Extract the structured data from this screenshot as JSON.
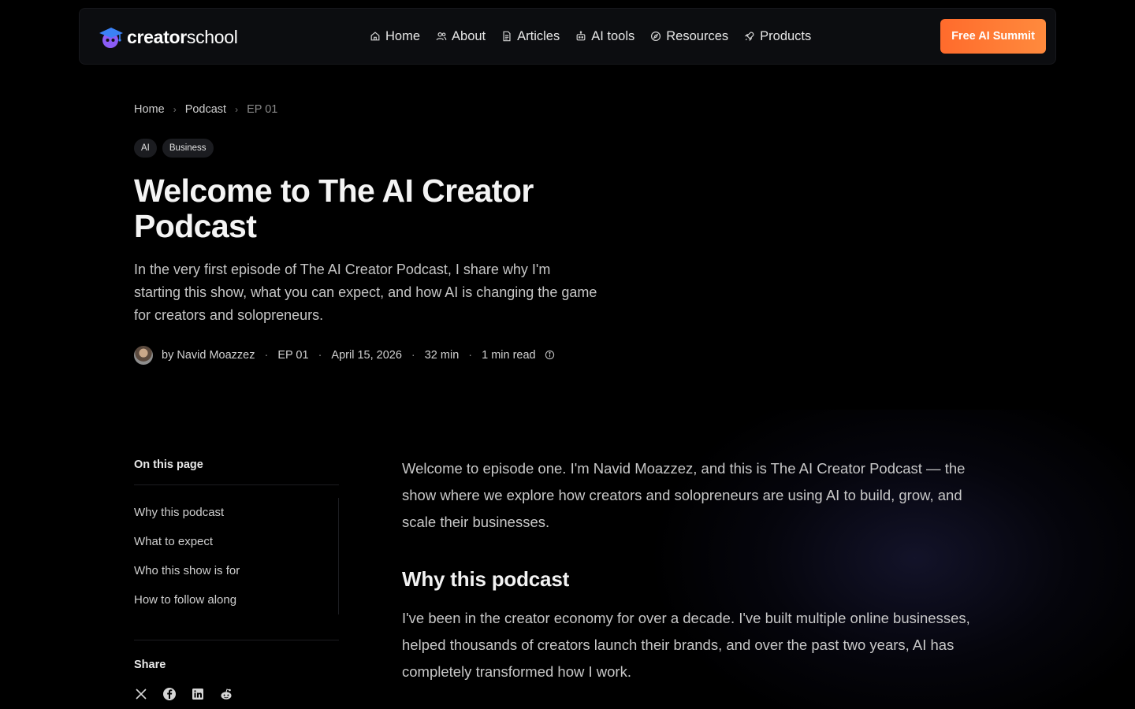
{
  "brand": {
    "logo_text_bold": "creator",
    "logo_text_light": "school",
    "accent_color": "#ff7a33"
  },
  "nav": {
    "items": [
      {
        "label": "Home",
        "icon": "home-icon"
      },
      {
        "label": "About",
        "icon": "users-icon"
      },
      {
        "label": "Articles",
        "icon": "document-icon"
      },
      {
        "label": "AI tools",
        "icon": "robot-icon"
      },
      {
        "label": "Resources",
        "icon": "compass-icon"
      },
      {
        "label": "Products",
        "icon": "rocket-icon"
      }
    ],
    "cta_label": "Free AI Summit"
  },
  "breadcrumb": {
    "items": [
      "Home",
      "Podcast",
      "EP 01"
    ]
  },
  "tags": [
    "AI",
    "Business"
  ],
  "hero": {
    "title": "Welcome to The AI Creator Podcast",
    "lead": "In the very first episode of The AI Creator Podcast, I share why I'm starting this show, what you can expect, and how AI is changing the game for creators and solopreneurs."
  },
  "meta": {
    "author": "by Navid Moazzez",
    "episode": "EP 01",
    "date": "April 15, 2026",
    "duration": "32 min",
    "read_time": "1 min read"
  },
  "toc": {
    "title": "On this page",
    "items": [
      "Why this podcast",
      "What to expect",
      "Who this show is for",
      "How to follow along"
    ]
  },
  "share": {
    "title": "Share",
    "icons": [
      "x-icon",
      "facebook-icon",
      "linkedin-icon",
      "reddit-icon"
    ]
  },
  "article": {
    "intro": "Welcome to episode one. I'm Navid Moazzez, and this is The AI Creator Podcast — the show where we explore how creators and solopreneurs are using AI to build, grow, and scale their businesses.",
    "section1_heading": "Why this podcast",
    "section1_body": "I've been in the creator economy for over a decade. I've built multiple online businesses, helped thousands of creators launch their brands, and over the past two years, AI has completely transformed how I work."
  }
}
